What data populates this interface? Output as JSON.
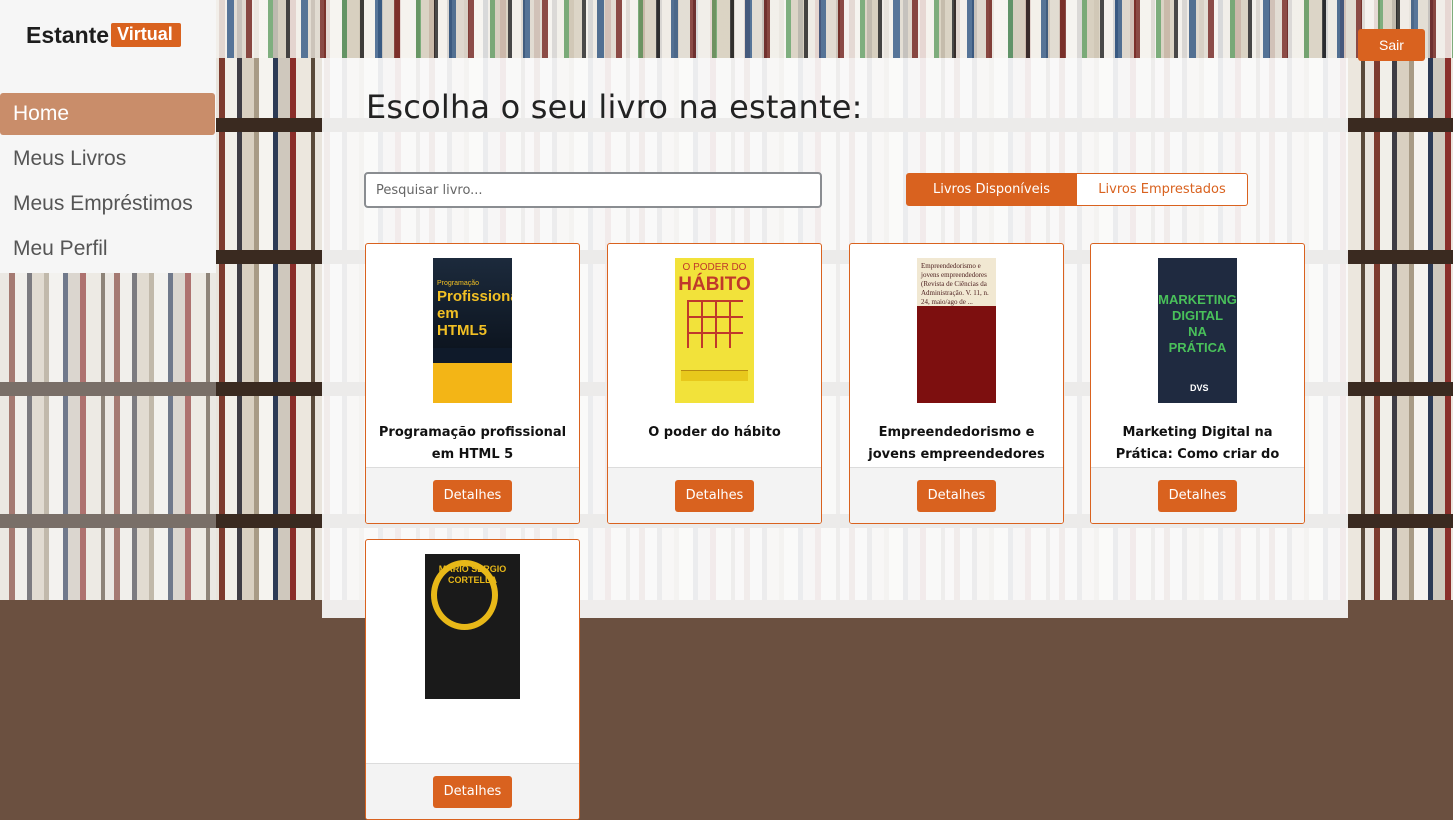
{
  "brand": {
    "name": "Estante",
    "badge": "Virtual"
  },
  "nav": {
    "items": [
      {
        "label": "Home",
        "active": true
      },
      {
        "label": "Meus Livros",
        "active": false
      },
      {
        "label": "Meus Empréstimos",
        "active": false
      },
      {
        "label": "Meu Perfil",
        "active": false
      }
    ]
  },
  "header": {
    "logout_label": "Sair"
  },
  "main": {
    "title": "Escolha o seu livro na estante:",
    "search": {
      "placeholder": "Pesquisar livro...",
      "value": ""
    },
    "tabs": [
      {
        "label": "Livros Disponíveis",
        "active": true
      },
      {
        "label": "Livros Emprestados",
        "active": false
      }
    ],
    "books": [
      {
        "title": "Programação profissional em HTML 5",
        "details_label": "Detalhes",
        "cover": {
          "line1": "Programação",
          "line2": "Profissional em",
          "line3": "HTML5"
        }
      },
      {
        "title": "O poder do hábito",
        "details_label": "Detalhes",
        "cover": {
          "line1": "O PODER DO",
          "line2": "HÁBITO",
          "line3": "CHARLES DUHIGG"
        }
      },
      {
        "title": "Empreendedorismo e jovens empreendedores",
        "details_label": "Detalhes",
        "cover": {
          "line1": "Empreendedorismo e jovens empreendedores (Revista de Ciências da Administração. V. 11, n. 24, maio/ago de ..."
        }
      },
      {
        "title": "Marketing Digital na Prática: Como criar do",
        "details_label": "Detalhes",
        "cover": {
          "line1": "MARKETING",
          "line2": "DIGITAL",
          "line3": "NA PRÁTICA",
          "publisher": "DVS"
        }
      },
      {
        "title": "",
        "details_label": "Detalhes",
        "cover": {
          "line1": "MARIO SERGIO",
          "line2": "CORTELLA"
        }
      }
    ]
  },
  "colors": {
    "accent": "#d9621f",
    "nav_active_bg": "#c98d6a"
  }
}
